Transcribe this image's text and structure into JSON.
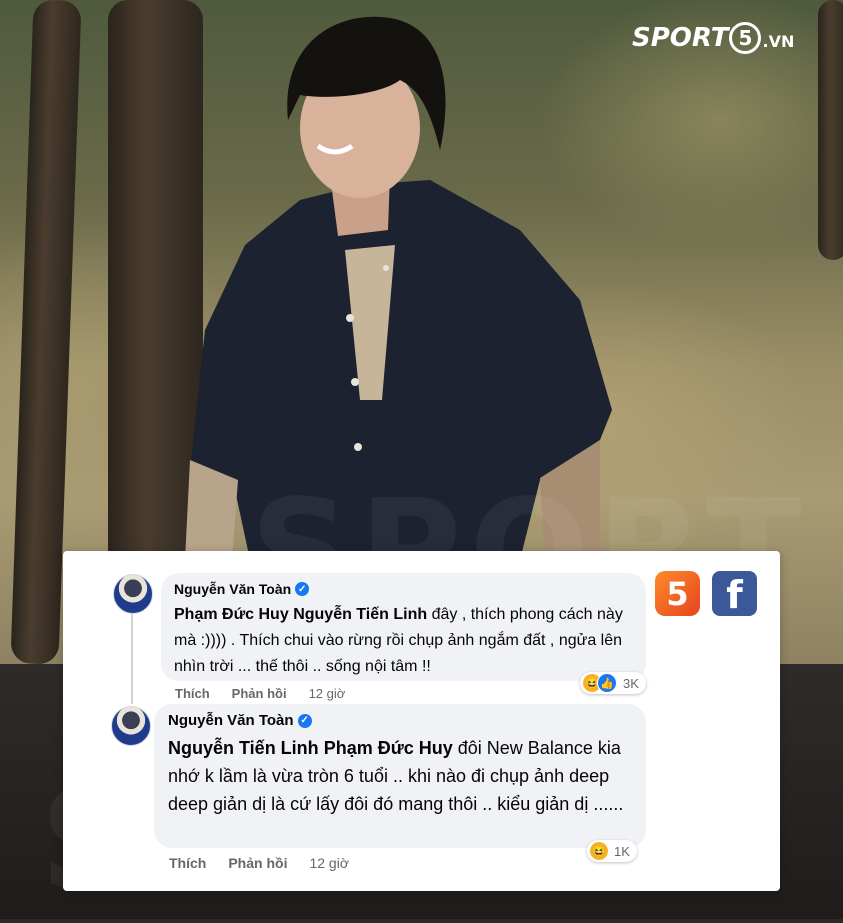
{
  "brand": {
    "logo_word": "SPORT",
    "logo_five": "5",
    "logo_tld": ".VN",
    "watermark_text": "SPORT"
  },
  "badges": {
    "five_label": "5",
    "facebook_label": "f"
  },
  "comments": [
    {
      "author": "Nguyễn Văn Toàn",
      "tags": [
        "Phạm Đức Huy",
        "Nguyễn Tiến Linh"
      ],
      "text": "Phạm Đức Huy Nguyễn Tiến Linh đây , thích phong cách này mà :)))) . Thích chui vào rừng rồi chụp ảnh ngắm đất , ngửa lên nhìn trời ... thế thôi .. sống nội tâm !!",
      "text_rest": " đây , thích phong cách này mà :)))) . Thích chui vào rừng rồi chụp ảnh ngắm đất , ngửa lên nhìn trời ... thế thôi .. sống nội tâm !!",
      "like_label": "Thích",
      "reply_label": "Phản hồi",
      "time": "12 giờ",
      "reactions": [
        "haha",
        "like"
      ],
      "reaction_count": "3K"
    },
    {
      "author": "Nguyễn Văn Toàn",
      "tags": [
        "Nguyễn Tiến Linh",
        "Phạm Đức Huy"
      ],
      "text": "Nguyễn Tiến Linh Phạm Đức Huy đôi New Balance kia nhớ k lầm là vừa tròn 6 tuổi .. khi nào đi chụp ảnh deep deep giản dị là cứ lấy đôi đó mang thôi .. kiểu giản dị ......",
      "text_rest": " đôi New Balance kia nhớ k lầm là vừa tròn 6 tuổi .. khi nào đi chụp ảnh deep deep giản dị là cứ lấy đôi đó mang thôi .. kiểu giản dị ......",
      "like_label": "Thích",
      "reply_label": "Phản hồi",
      "time": "12 giờ",
      "reactions": [
        "haha"
      ],
      "reaction_count": "1K"
    }
  ],
  "colors": {
    "facebook_blue": "#1877f2",
    "bubble_bg": "#f0f2f5",
    "badge_orange": "#f26a24",
    "badge_facebook": "#3b5998"
  }
}
